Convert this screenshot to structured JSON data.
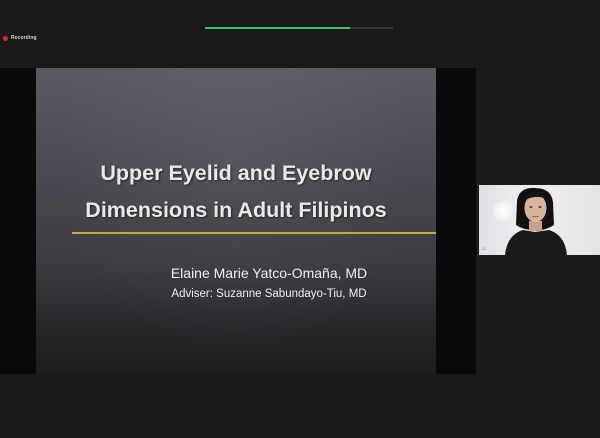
{
  "recording": {
    "label": "Recording",
    "indicator_color": "#e02828"
  },
  "progress": {
    "fraction": 0.77,
    "fill_color": "#35c55e"
  },
  "slide": {
    "title_line1": "Upper Eyelid and Eyebrow",
    "title_line2": "Dimensions in Adult Filipinos",
    "author": "Elaine Marie Yatco-Omaña, MD",
    "adviser": "Adviser: Suzanne Sabundayo-Tiu, MD",
    "accent_color": "#d2a23c"
  },
  "participant_video": {
    "icon": "participant-camera-thumbnail"
  }
}
